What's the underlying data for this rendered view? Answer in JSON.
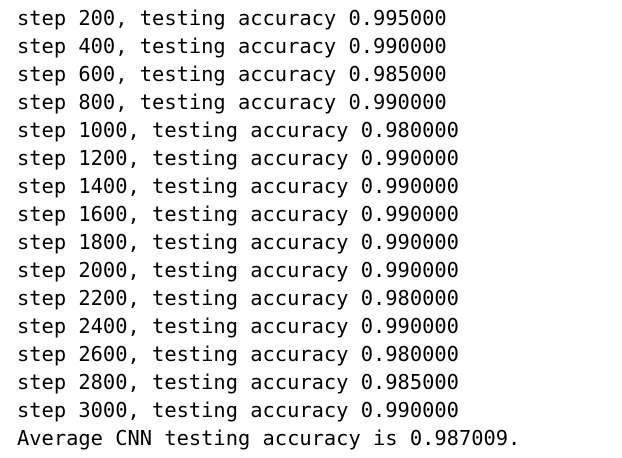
{
  "output": {
    "lines": [
      "step 200, testing accuracy 0.995000",
      "step 400, testing accuracy 0.990000",
      "step 600, testing accuracy 0.985000",
      "step 800, testing accuracy 0.990000",
      "step 1000, testing accuracy 0.980000",
      "step 1200, testing accuracy 0.990000",
      "step 1400, testing accuracy 0.990000",
      "step 1600, testing accuracy 0.990000",
      "step 1800, testing accuracy 0.990000",
      "step 2000, testing accuracy 0.990000",
      "step 2200, testing accuracy 0.980000",
      "step 2400, testing accuracy 0.990000",
      "step 2600, testing accuracy 0.980000",
      "step 2800, testing accuracy 0.985000",
      "step 3000, testing accuracy 0.990000",
      "Average CNN testing accuracy is 0.987009."
    ]
  }
}
